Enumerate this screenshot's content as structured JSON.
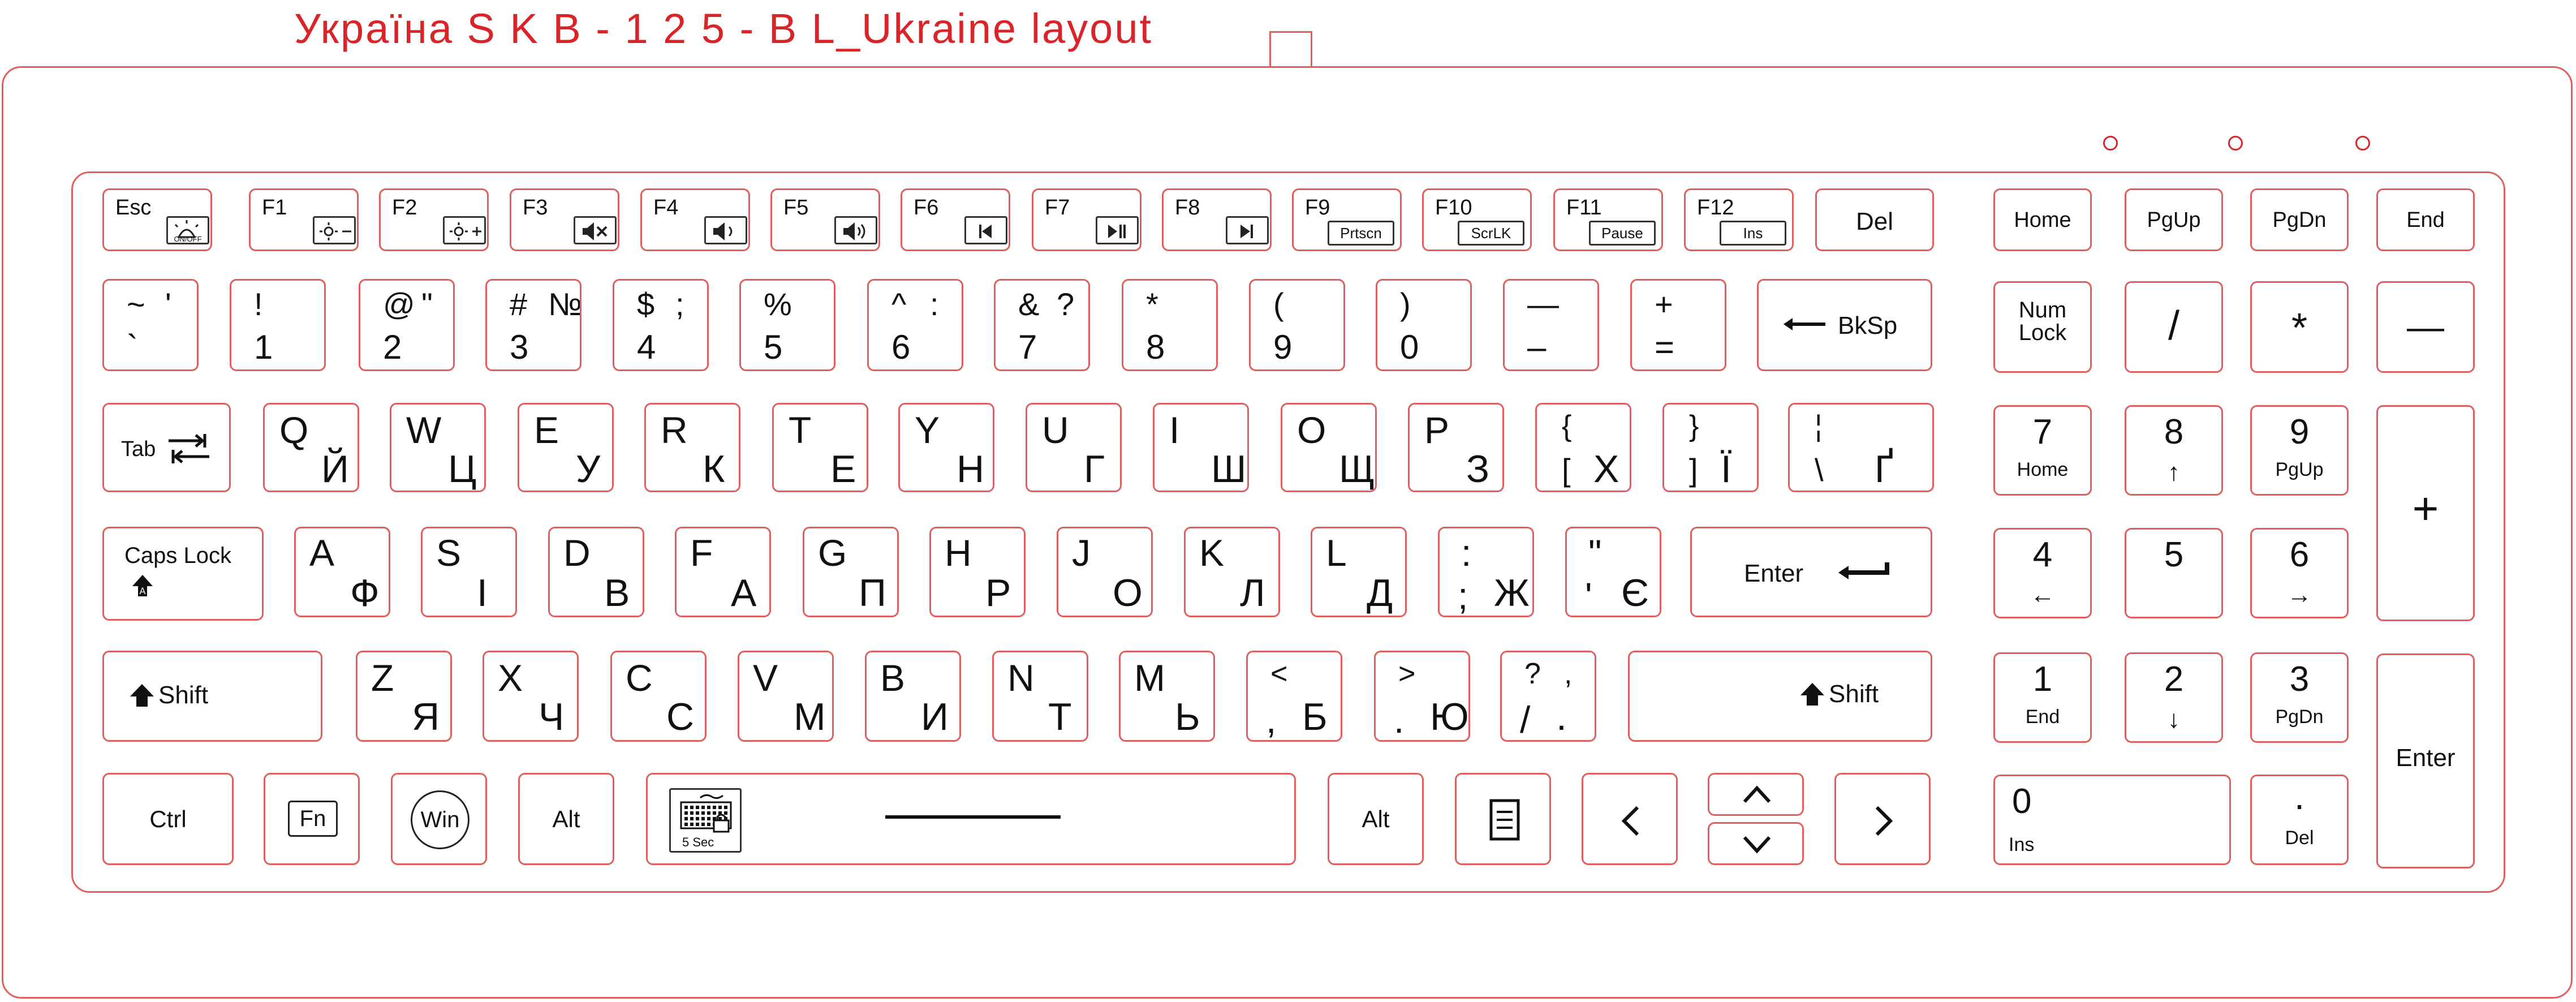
{
  "title": "Україна S K B - 1 2 5 - B L_Ukraine layout",
  "colors": {
    "outline": "#e06060",
    "accent": "#d9252a",
    "glyph": "#111111"
  },
  "leds": [
    "led-1",
    "led-2",
    "led-3"
  ],
  "fkeys": [
    {
      "label": "Esc",
      "sub": "ON/OFF",
      "icon": "backlight-icon"
    },
    {
      "label": "F1",
      "icon": "brightness-down-icon",
      "sub": ""
    },
    {
      "label": "F2",
      "icon": "brightness-up-icon",
      "sub": ""
    },
    {
      "label": "F3",
      "icon": "mute-icon",
      "sub": ""
    },
    {
      "label": "F4",
      "icon": "volume-down-icon",
      "sub": ""
    },
    {
      "label": "F5",
      "icon": "volume-up-icon",
      "sub": ""
    },
    {
      "label": "F6",
      "icon": "previous-track-icon",
      "sub": ""
    },
    {
      "label": "F7",
      "icon": "play-pause-icon",
      "sub": ""
    },
    {
      "label": "F8",
      "icon": "next-track-icon",
      "sub": ""
    },
    {
      "label": "F9",
      "sub": "Prtscn"
    },
    {
      "label": "F10",
      "sub": "ScrLK"
    },
    {
      "label": "F11",
      "sub": "Pause"
    },
    {
      "label": "F12",
      "sub": "Ins"
    },
    {
      "label": "Del"
    }
  ],
  "nav_top": [
    "Home",
    "PgUp",
    "PgDn",
    "End"
  ],
  "number_row": [
    {
      "ul": "~",
      "ur": "'",
      "ll": "`",
      "lr": ""
    },
    {
      "ul": "!",
      "ur": "",
      "ll": "1",
      "lr": ""
    },
    {
      "ul": "@",
      "ur": "\"",
      "ll": "2",
      "lr": ""
    },
    {
      "ul": "#",
      "ur": "№",
      "ll": "3",
      "lr": ""
    },
    {
      "ul": "$",
      "ur": ";",
      "ll": "4",
      "lr": ""
    },
    {
      "ul": "%",
      "ur": "",
      "ll": "5",
      "lr": ""
    },
    {
      "ul": "^",
      "ur": ":",
      "ll": "6",
      "lr": ""
    },
    {
      "ul": "&",
      "ur": "?",
      "ll": "7",
      "lr": ""
    },
    {
      "ul": "*",
      "ur": "",
      "ll": "8",
      "lr": ""
    },
    {
      "ul": "(",
      "ur": "",
      "ll": "9",
      "lr": ""
    },
    {
      "ul": ")",
      "ur": "",
      "ll": "0",
      "lr": ""
    },
    {
      "ul": "—",
      "ur": "",
      "ll": "–",
      "lr": ""
    },
    {
      "ul": "+",
      "ur": "",
      "ll": "=",
      "lr": ""
    }
  ],
  "backspace": "BkSp",
  "tab": "Tab",
  "row_q": [
    {
      "ul": "Q",
      "lr": "Й",
      "ll": ""
    },
    {
      "ul": "W",
      "lr": "Ц",
      "ll": ""
    },
    {
      "ul": "E",
      "lr": "У",
      "ll": ""
    },
    {
      "ul": "R",
      "lr": "К",
      "ll": ""
    },
    {
      "ul": "T",
      "lr": "Е",
      "ll": ""
    },
    {
      "ul": "Y",
      "lr": "Н",
      "ll": ""
    },
    {
      "ul": "U",
      "lr": "Г",
      "ll": ""
    },
    {
      "ul": "I",
      "lr": "Ш",
      "ll": ""
    },
    {
      "ul": "O",
      "lr": "Щ",
      "ll": ""
    },
    {
      "ul": "P",
      "lr": "З",
      "ll": ""
    },
    {
      "ul": "{",
      "ll": "[",
      "lr": "Х"
    },
    {
      "ul": "}",
      "ll": "]",
      "lr": "Ї"
    },
    {
      "ul": "¦",
      "ll": "\\",
      "lr": "Ґ"
    }
  ],
  "caps": "Caps Lock",
  "row_a": [
    {
      "ul": "A",
      "lr": "Ф",
      "ll": ""
    },
    {
      "ul": "S",
      "lr": "І",
      "ll": ""
    },
    {
      "ul": "D",
      "lr": "В",
      "ll": ""
    },
    {
      "ul": "F",
      "lr": "А",
      "ll": ""
    },
    {
      "ul": "G",
      "lr": "П",
      "ll": ""
    },
    {
      "ul": "H",
      "lr": "Р",
      "ll": ""
    },
    {
      "ul": "J",
      "lr": "О",
      "ll": ""
    },
    {
      "ul": "K",
      "lr": "Л",
      "ll": ""
    },
    {
      "ul": "L",
      "lr": "Д",
      "ll": ""
    },
    {
      "ul": ":",
      "ll": ";",
      "lr": "Ж"
    },
    {
      "ul": "\"",
      "ll": "'",
      "lr": "Є"
    }
  ],
  "enter": "Enter",
  "shift": "Shift",
  "row_z": [
    {
      "ul": "Z",
      "lr": "Я",
      "ll": ""
    },
    {
      "ul": "X",
      "lr": "Ч",
      "ll": ""
    },
    {
      "ul": "C",
      "lr": "С",
      "ll": ""
    },
    {
      "ul": "V",
      "lr": "М",
      "ll": ""
    },
    {
      "ul": "B",
      "lr": "И",
      "ll": ""
    },
    {
      "ul": "N",
      "lr": "Т",
      "ll": ""
    },
    {
      "ul": "M",
      "lr": "Ь",
      "ll": ""
    },
    {
      "ul": "<",
      "ll": ",",
      "lr": "Б"
    },
    {
      "ul": ">",
      "ll": ".",
      "lr": "Ю"
    },
    {
      "ul": "?",
      "ur": ",",
      "ll": "/",
      "lr": "."
    }
  ],
  "bottom": {
    "ctrl": "Ctrl",
    "fn": "Fn",
    "win": "Win",
    "alt": "Alt",
    "alt_r": "Alt",
    "space_sub": "5 Sec"
  },
  "numpad": {
    "numlock": [
      "Num",
      "Lock"
    ],
    "slash": "/",
    "star": "*",
    "minus": "—",
    "plus": "+",
    "enter": "Enter",
    "k7": [
      "7",
      "Home"
    ],
    "k8": [
      "8",
      "↑"
    ],
    "k9": [
      "9",
      "PgUp"
    ],
    "k4": [
      "4",
      "←"
    ],
    "k5": [
      "5",
      ""
    ],
    "k6": [
      "6",
      "→"
    ],
    "k1": [
      "1",
      "End"
    ],
    "k2": [
      "2",
      "↓"
    ],
    "k3": [
      "3",
      "PgDn"
    ],
    "k0": [
      "0",
      "Ins"
    ],
    "kdot": [
      ".",
      "Del"
    ]
  }
}
